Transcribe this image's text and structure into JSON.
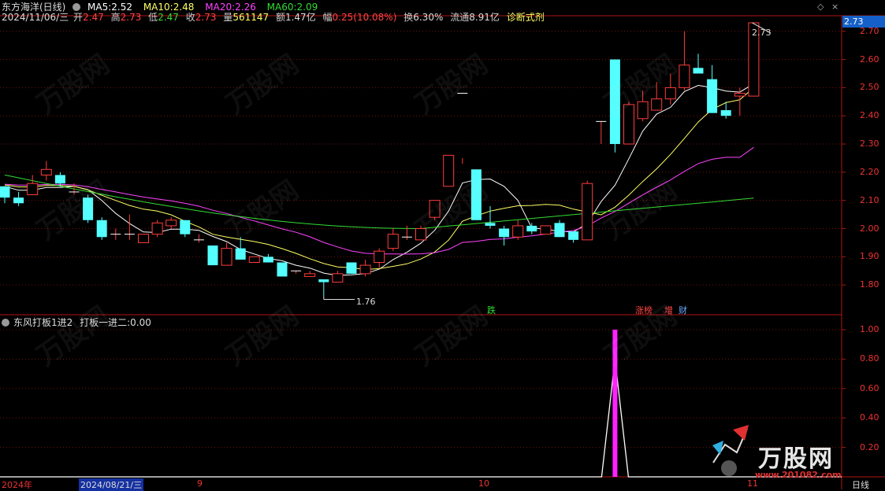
{
  "header": {
    "title": "东方海洋(日线)",
    "ma": [
      {
        "label": "MA5:",
        "value": "2.52",
        "color": "#ffffff"
      },
      {
        "label": "MA10:",
        "value": "2.48",
        "color": "#ffff66"
      },
      {
        "label": "MA20:",
        "value": "2.26",
        "color": "#ff44ff"
      },
      {
        "label": "MA60:",
        "value": "2.09",
        "color": "#33dd33"
      }
    ],
    "info": {
      "date": "2024/11/06/三",
      "open_l": "开",
      "open_v": "2.47",
      "high_l": "高",
      "high_v": "2.73",
      "low_l": "低",
      "low_v": "2.47",
      "close_l": "收",
      "close_v": "2.73",
      "vol_l": "量",
      "vol_v": "561147",
      "amt_l": "额",
      "amt_v": "1.47亿",
      "amp_l": "幅",
      "amp_v": "0.25(10.08%)",
      "turn_l": "换",
      "turn_v": "6.30%",
      "float_l": "流通",
      "float_v": "8.91亿",
      "diag": "诊断式剂"
    }
  },
  "indicator": {
    "title": "东风打板1进2",
    "line_label": "打板一进二:",
    "line_value": "0.00"
  },
  "price_axis": {
    "current": "2.73",
    "ticks": [
      "2.70",
      "2.60",
      "2.50",
      "2.40",
      "2.30",
      "2.20",
      "2.10",
      "2.00",
      "1.90",
      "1.80"
    ]
  },
  "indicator_axis": {
    "ticks": [
      "1.00",
      "0.80",
      "0.60",
      "0.40",
      "0.20"
    ]
  },
  "time_axis": {
    "labels": [
      "2024年",
      "2024/08/21/三",
      "9",
      "10",
      "11",
      "日线"
    ]
  },
  "annotations": {
    "high": "2.73",
    "low": "1.76"
  },
  "event_tags": [
    {
      "text": "跌",
      "color": "#33dd33"
    },
    {
      "text": "涨榜",
      "color": "#ff4444"
    },
    {
      "text": "增",
      "color": "#ff4444"
    },
    {
      "text": "财",
      "color": "#66aaff"
    }
  ],
  "watermark": {
    "brand": "万股网",
    "url": "www.201082.com"
  },
  "candles": [
    [
      2.15,
      2.15,
      2.09,
      2.11
    ],
    [
      2.11,
      2.13,
      2.08,
      2.09
    ],
    [
      2.12,
      2.19,
      2.12,
      2.16
    ],
    [
      2.19,
      2.24,
      2.17,
      2.21
    ],
    [
      2.19,
      2.2,
      2.15,
      2.16
    ],
    [
      2.13,
      2.16,
      2.12,
      2.13
    ],
    [
      2.11,
      2.12,
      2.02,
      2.03
    ],
    [
      2.03,
      2.04,
      1.96,
      1.97
    ],
    [
      1.98,
      2.0,
      1.96,
      1.98
    ],
    [
      1.98,
      2.05,
      1.96,
      1.98
    ],
    [
      1.95,
      1.98,
      1.95,
      1.98
    ],
    [
      1.98,
      2.03,
      1.97,
      2.02
    ],
    [
      2.01,
      2.04,
      2.0,
      2.03
    ],
    [
      2.03,
      2.03,
      1.97,
      1.98
    ],
    [
      1.96,
      1.98,
      1.95,
      1.96
    ],
    [
      1.94,
      1.94,
      1.87,
      1.87
    ],
    [
      1.87,
      1.95,
      1.87,
      1.93
    ],
    [
      1.93,
      1.97,
      1.89,
      1.89
    ],
    [
      1.88,
      1.9,
      1.88,
      1.9
    ],
    [
      1.9,
      1.91,
      1.88,
      1.88
    ],
    [
      1.88,
      1.88,
      1.83,
      1.83
    ],
    [
      1.85,
      1.85,
      1.84,
      1.85
    ],
    [
      1.83,
      1.85,
      1.83,
      1.84
    ],
    [
      1.82,
      1.82,
      1.76,
      1.81
    ],
    [
      1.81,
      1.85,
      1.81,
      1.84
    ],
    [
      1.88,
      1.88,
      1.84,
      1.84
    ],
    [
      1.84,
      1.89,
      1.83,
      1.87
    ],
    [
      1.88,
      1.93,
      1.86,
      1.92
    ],
    [
      1.93,
      2.0,
      1.92,
      1.98
    ],
    [
      1.97,
      2.01,
      1.96,
      1.97
    ],
    [
      1.96,
      2.01,
      1.96,
      2.0
    ],
    [
      2.04,
      2.09,
      2.03,
      2.1
    ],
    [
      2.15,
      2.25,
      2.15,
      2.26
    ],
    [
      2.48,
      2.25,
      2.23,
      2.48
    ],
    [
      2.21,
      2.21,
      2.03,
      2.03
    ],
    [
      2.02,
      2.08,
      2.0,
      2.01
    ],
    [
      2.0,
      2.01,
      1.94,
      1.97
    ],
    [
      1.97,
      2.03,
      1.96,
      2.01
    ],
    [
      2.01,
      2.02,
      1.98,
      1.99
    ],
    [
      1.98,
      2.01,
      1.98,
      2.01
    ],
    [
      2.02,
      2.03,
      1.97,
      1.97
    ],
    [
      1.99,
      1.99,
      1.95,
      1.96
    ],
    [
      1.96,
      2.17,
      1.96,
      2.16
    ],
    [
      2.38,
      2.38,
      2.3,
      2.38
    ],
    [
      2.6,
      2.6,
      2.27,
      2.3
    ],
    [
      2.3,
      2.45,
      2.3,
      2.44
    ],
    [
      2.39,
      2.49,
      2.38,
      2.45
    ],
    [
      2.42,
      2.52,
      2.42,
      2.46
    ],
    [
      2.46,
      2.55,
      2.44,
      2.5
    ],
    [
      2.5,
      2.7,
      2.49,
      2.58
    ],
    [
      2.57,
      2.62,
      2.56,
      2.55
    ],
    [
      2.53,
      2.58,
      2.41,
      2.41
    ],
    [
      2.42,
      2.45,
      2.39,
      2.4
    ],
    [
      2.47,
      2.5,
      2.4,
      2.48
    ],
    [
      2.47,
      2.73,
      2.47,
      2.73
    ]
  ],
  "signal": {
    "index": 44,
    "value": 1.0
  }
}
